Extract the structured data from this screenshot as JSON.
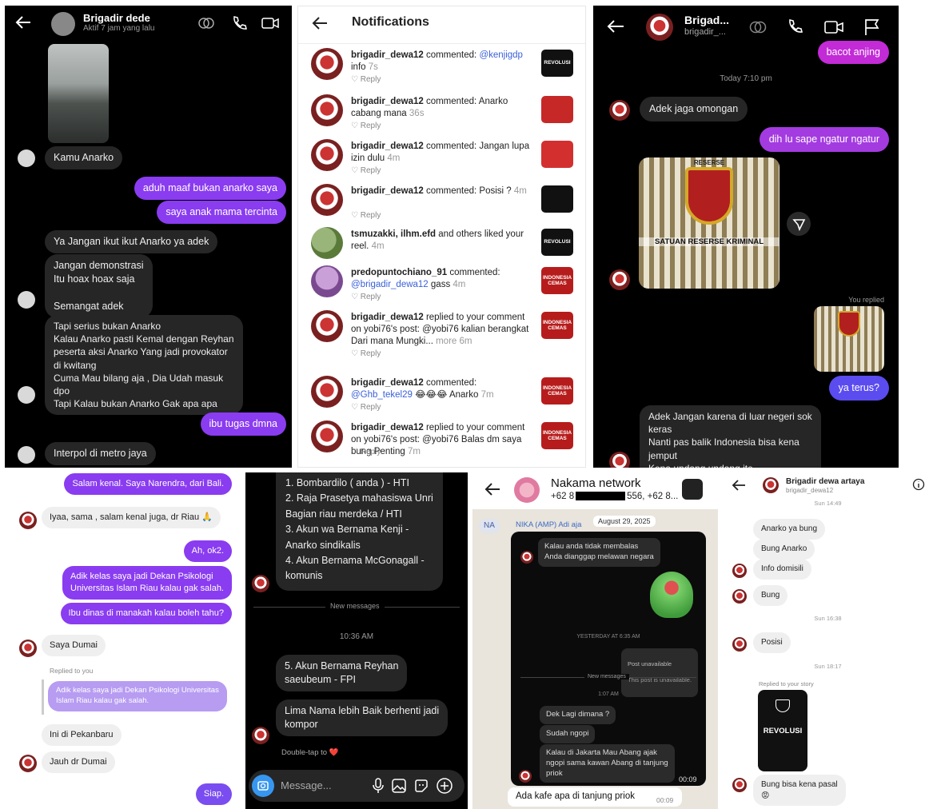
{
  "p1": {
    "name": "Brigadir dede",
    "status": "Aktif 7 jam yang lalu",
    "messages": [
      {
        "side": "in",
        "text": "Kamu Anarko"
      },
      {
        "side": "out",
        "text": "aduh maaf bukan anarko saya"
      },
      {
        "side": "out",
        "text": "saya anak mama tercinta"
      },
      {
        "side": "in",
        "text": "Ya Jangan ikut ikut Anarko ya adek"
      },
      {
        "side": "in",
        "text": "Jangan demonstrasi\nItu hoax hoax saja\n\nSemangat adek"
      },
      {
        "side": "in",
        "text": "Tapi serius bukan Anarko\nKalau Anarko pasti Kemal dengan Reyhan\npeserta aksi Anarko Yang jadi provokator\ndi kwitang\nCuma Mau bilang aja , Dia Udah masuk\ndpo\nTapi Kalau bukan Anarko Gak apa apa"
      },
      {
        "side": "out",
        "text": "ibu tugas dmna"
      },
      {
        "side": "in",
        "text": "Interpol di metro jaya"
      }
    ]
  },
  "p2": {
    "title": "Notifications",
    "reply_label": "Reply",
    "items": [
      {
        "user": "brigadir_dewa12",
        "action": " commented: ",
        "mention": "@kenjigdp",
        "text": " info",
        "time": " 7s",
        "thumb": "REVOLUSI",
        "thumb_color": "#111111"
      },
      {
        "user": "brigadir_dewa12",
        "action": " commented: Anarko cabang mana",
        "mention": "",
        "text": "",
        "time": " 36s",
        "thumb": "",
        "thumb_color": "#c62828"
      },
      {
        "user": "brigadir_dewa12",
        "action": " commented: Jangan lupa izin dulu",
        "mention": "",
        "text": "",
        "time": " 4m",
        "thumb": "",
        "thumb_color": "#d32f2f"
      },
      {
        "user": "brigadir_dewa12",
        "action": " commented: Posisi ?",
        "mention": "",
        "text": "",
        "time": " 4m",
        "thumb": "",
        "thumb_color": "#111111"
      },
      {
        "user": "tsmuzakki, ilhm.efd",
        "action": " and others liked your reel.",
        "mention": "",
        "text": "",
        "time": " 4m",
        "thumb": "REVOLUSI",
        "thumb_color": "#111111"
      },
      {
        "user": "predopuntochiano_91",
        "action": " commented: ",
        "mention": "@brigadir_dewa12",
        "text": " gass",
        "time": " 4m",
        "thumb": "INDONESIA CEMAS",
        "thumb_color": "#b71c1c"
      },
      {
        "user": "brigadir_dewa12",
        "action": " replied to your comment on ",
        "mention": "",
        "text": "yobi76's post: @yobi76 kalian berangkat Dari mana Mungki...",
        "time": " more 6m",
        "thumb": "INDONESIA CEMAS",
        "thumb_color": "#b71c1c"
      },
      {
        "user": "brigadir_dewa12",
        "action": " commented: ",
        "mention": "@Ghb_tekel29",
        "text": " 😂😂😂 Anarko",
        "time": " 7m",
        "thumb": "INDONESIA CEMAS",
        "thumb_color": "#b71c1c"
      },
      {
        "user": "brigadir_dewa12",
        "action": " replied to your comment on ",
        "mention": "",
        "text": "yobi76's post: @yobi76 Balas dm saya bung Penting",
        "time": " 7m",
        "thumb": "INDONESIA CEMAS",
        "thumb_color": "#b71c1c"
      }
    ]
  },
  "p3": {
    "name": "Brigad...",
    "handle": "brigadir_...",
    "out_top": "bacot anjing",
    "time_label": "Today 7:10 pm",
    "in1": "Adek jaga omongan",
    "out1": "dih lu sape ngatur ngatur",
    "image_caption": "SATUAN RESERSE KRIMINAL",
    "seal_text": "RESERSE",
    "you_replied": "You replied",
    "out2": "ya terus?",
    "in2": "Adek Jangan karena di luar negeri sok\nkeras\nNanti pas balik Indonesia bisa kena\njemput\nKena undang undang ite"
  },
  "p4": {
    "messages": [
      {
        "side": "out",
        "text": "Salam kenal. Saya Narendra, dari Bali."
      },
      {
        "side": "in",
        "text": "Iyaa, sama , salam kenal juga, dr Riau 🙏"
      },
      {
        "side": "out",
        "text": "Ah, ok2."
      },
      {
        "side": "out",
        "text": "Adik kelas saya jadi Dekan Psikologi\nUniversitas Islam Riau kalau gak salah."
      },
      {
        "side": "out",
        "text": "Ibu dinas di manakah kalau boleh tahu?"
      },
      {
        "side": "in",
        "text": "Saya Dumai"
      },
      {
        "side": "in",
        "text": "Ini di Pekanbaru"
      },
      {
        "side": "in",
        "text": "Jauh dr Dumai"
      },
      {
        "side": "out",
        "text": "Siap."
      }
    ],
    "replied_label": "Replied to you",
    "quoted": "Adik kelas saya jadi Dekan Psikologi Universitas\nIslam Riau kalau gak salah."
  },
  "p5": {
    "list": "1.  Bombardilo ( anda ) - HTI\n2.  Raja Prasetya mahasiswa Unri\nBagian riau merdeka / HTI\n3.  Akun wa Bernama Kenji -\nAnarko sindikalis\n4.  Akun Bernama McGonagall -\nkomunis",
    "new_messages": "New messages",
    "time": "10:36 AM",
    "msg5": "5.  Akun Bernama Reyhan\nsaeubeum  - FPI",
    "msg6": "Lima Nama lebih Baik berhenti jadi\nkompor",
    "double_tap": "Double-tap to ❤️",
    "placeholder": "Message..."
  },
  "p6": {
    "group_name": "Nakama network",
    "members_pre": "+62 8",
    "members_post": "556, +62 8...",
    "sender_initials": "NA",
    "sender": "NIKA (AMP) Adi aja",
    "date": "August 29, 2025",
    "fwd_text": "Kalau anda tidak membalas\nAnda dianggap melawan negara",
    "yesterday": "YESTERDAY AT 6:35 AM",
    "unavail_title": "Post unavailable",
    "unavail_sub": "This post is unavailable.",
    "new_messages": "New messages",
    "time2": "1:07 AM",
    "m1": "Dek Lagi dimana ?",
    "m2": "Sudah ngopi",
    "m3": "Kalau di Jakarta Mau Abang ajak\nngopi sama kawan Abang di tanjung\npriok",
    "inner_time": "00:09",
    "outer_msg": "Ada kafe apa di tanjung priok",
    "outer_time": "00:09"
  },
  "p7": {
    "name": "Brigadir dewa artaya",
    "handle": "brigadir_dewa12",
    "t1": "Sun 14:49",
    "m1": "Anarko ya bung",
    "m2": "Bung Anarko",
    "m3": "Info domisili",
    "m4": "Bung",
    "t2": "Sun 16:38",
    "m5": "Posisi",
    "t3": "Sun 18:17",
    "story_label": "Replied to your story",
    "story_text": "REVOLUSI",
    "m6": "Bung bisa kena pasal\n😡"
  }
}
